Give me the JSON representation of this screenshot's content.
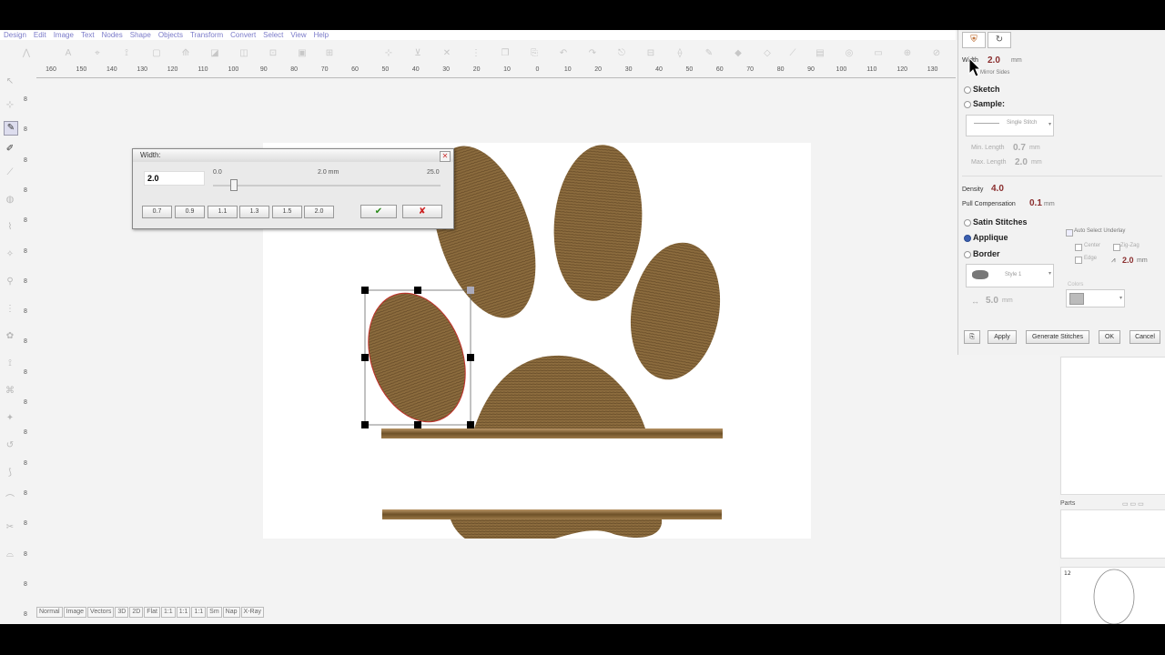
{
  "menu": [
    "Design",
    "Edit",
    "Image",
    "Text",
    "Nodes",
    "Shape",
    "Objects",
    "Transform",
    "Convert",
    "Select",
    "View",
    "Help"
  ],
  "ruler_ticks": [
    "160",
    "150",
    "140",
    "130",
    "120",
    "110",
    "100",
    "90",
    "80",
    "70",
    "60",
    "50",
    "40",
    "30",
    "20",
    "10",
    "0",
    "10",
    "20",
    "30",
    "40",
    "50",
    "60",
    "70",
    "80",
    "90",
    "100",
    "110",
    "120",
    "130"
  ],
  "vruler_ticks": [
    "8",
    "8",
    "8",
    "8",
    "8",
    "8",
    "8",
    "8",
    "8",
    "8",
    "8",
    "8",
    "8",
    "8",
    "8",
    "8",
    "8",
    "8"
  ],
  "view_tabs": [
    "Normal",
    "Image",
    "Vectors",
    "3D",
    "2D",
    "Flat",
    "1:1",
    "1:1",
    "1:1",
    "Sm",
    "Nap",
    "X-Ray"
  ],
  "width_dialog": {
    "title": "Width:",
    "value": "2.0",
    "min_label": "0.0",
    "current_label": "2.0 mm",
    "max_label": "25.0",
    "slider_value_mm": 2.0,
    "presets": [
      "0.7",
      "0.9",
      "1.1",
      "1.3",
      "1.5",
      "2.0"
    ],
    "ok_icon": "checkmark-icon",
    "cancel_icon": "x-icon"
  },
  "props": {
    "width_label": "Width",
    "width_value": "2.0",
    "width_unit": "mm",
    "mirror_sides": "Mirror Sides",
    "sketch": "Sketch",
    "sample": "Sample:",
    "sample_stitch": "Single Stitch",
    "min_length_label": "Min. Length",
    "min_length_value": "0.7",
    "max_length_label": "Max. Length",
    "max_length_value": "2.0",
    "unit": "mm",
    "density_label": "Density",
    "density_value": "4.0",
    "pull_comp_label": "Pull Compensation",
    "pull_comp_value": "0.1",
    "satin": "Satin Stitches",
    "applique": "Applique",
    "border": "Border",
    "auto_underlay": "Auto Select Underlay",
    "center": "Center",
    "zigzag": "Zig-Zag",
    "edge": "Edge",
    "zigzag_value": "2.0",
    "border_style": "Style 1",
    "border_width": "5.0",
    "color_label": "Colors",
    "btn_apply": "Apply",
    "btn_generate": "Generate Stitches",
    "btn_ok": "OK",
    "btn_cancel": "Cancel"
  },
  "side_panel": {
    "parts_label": "Parts"
  },
  "colors": {
    "stitch_brown": "#8a6a3c",
    "stitch_dark": "#6e5230",
    "bar_brown": "#7a5a2e",
    "accent": "#3b5fb0"
  }
}
